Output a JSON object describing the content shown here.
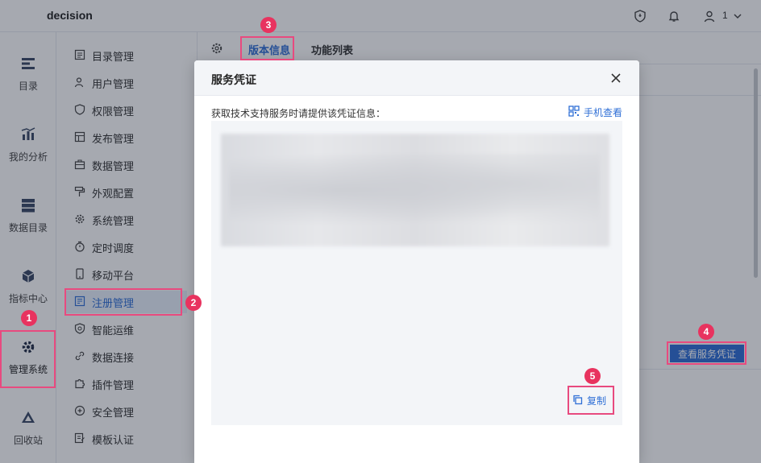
{
  "app": {
    "brand": "decision",
    "user_count": "1"
  },
  "leftnav": {
    "items": [
      {
        "label": "目录",
        "icon": "catalog-icon"
      },
      {
        "label": "我的分析",
        "icon": "analysis-icon"
      },
      {
        "label": "数据目录",
        "icon": "data-catalog-icon"
      },
      {
        "label": "指标中心",
        "icon": "metrics-icon"
      },
      {
        "label": "管理系统",
        "icon": "gear-icon"
      },
      {
        "label": "回收站",
        "icon": "recycle-icon"
      }
    ]
  },
  "subnav": {
    "items": [
      {
        "label": "目录管理"
      },
      {
        "label": "用户管理"
      },
      {
        "label": "权限管理"
      },
      {
        "label": "发布管理"
      },
      {
        "label": "数据管理"
      },
      {
        "label": "外观配置"
      },
      {
        "label": "系统管理"
      },
      {
        "label": "定时调度"
      },
      {
        "label": "移动平台"
      },
      {
        "label": "注册管理"
      },
      {
        "label": "智能运维"
      },
      {
        "label": "数据连接"
      },
      {
        "label": "插件管理"
      },
      {
        "label": "安全管理"
      },
      {
        "label": "模板认证"
      }
    ]
  },
  "tabs": {
    "version": "版本信息",
    "features": "功能列表"
  },
  "main": {
    "view_cred_button": "查看服务凭证"
  },
  "modal": {
    "title": "服务凭证",
    "description": "获取技术支持服务时请提供该凭证信息：",
    "phone_view": "手机查看",
    "copy": "复制"
  },
  "steps": [
    "1",
    "2",
    "3",
    "4",
    "5"
  ],
  "colors": {
    "accent": "#2f6fd6",
    "highlight": "#e84a7f",
    "badge": "#e8335f"
  }
}
